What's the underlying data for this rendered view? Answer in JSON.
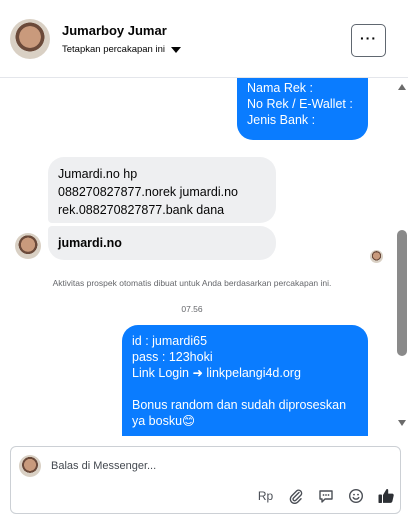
{
  "header": {
    "name": "Jumarboy Jumar",
    "subtitle": "Tetapkan percakapan ini",
    "more_label": "···"
  },
  "thread": {
    "outgoing_first": {
      "lines": [
        "Nama Rek :",
        "No Rek / E-Wallet :",
        "Jenis Bank :"
      ]
    },
    "incoming": [
      {
        "lines": [
          "Jumardi.no hp",
          "088270827877.norek jumardi.no",
          "rek.088270827877.bank dana"
        ]
      },
      {
        "lines": [
          "jumardi.no"
        ]
      }
    ],
    "notice": "Aktivitas prospek otomatis dibuat untuk Anda berdasarkan percakapan ini.",
    "timestamp": "07.56",
    "outgoing_last": {
      "lines": [
        "id : jumardi65",
        "pass : 123hoki",
        "Link Login ➜ linkpelangi4d.org",
        "",
        "Bonus random dan sudah diproseskan",
        "ya bosku😊"
      ]
    }
  },
  "composer": {
    "placeholder": "Balas di Messenger...",
    "tools": {
      "reply_label": "Rp",
      "attach_icon": "paperclip-icon",
      "saved_reply_icon": "chat-bubble-icon",
      "emoji_icon": "smiley-icon",
      "like_icon": "thumbs-up-icon"
    }
  },
  "colors": {
    "outgoing_bubble": "#0a7cff",
    "incoming_bubble": "#eeeff1",
    "meta_text": "#65676b"
  }
}
